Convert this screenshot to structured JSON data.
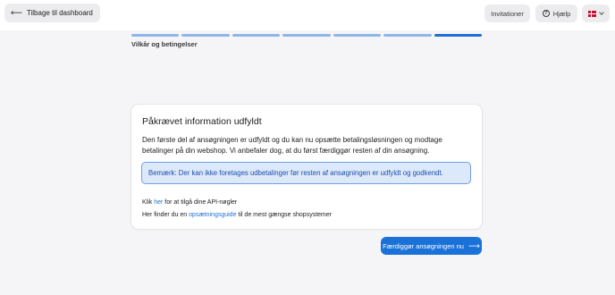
{
  "header": {
    "back_label": "Tilbage til dashboard",
    "invitations_label": "Invitationer",
    "help_label": "Hjælp",
    "language_flag": "flag-denmark"
  },
  "progress": {
    "total_steps": 7,
    "active_step": 7,
    "current_label": "Vilkår og betingelser",
    "colors": {
      "done": "#8fb6ea",
      "active": "#1d6fd6"
    }
  },
  "card": {
    "title": "Påkrævet information udfyldt",
    "body": "Den første del af ansøgningen er udfyldt og du kan nu opsætte betalingsløsningen og modtage betalinger på din webshop. Vi anbefaler dog, at du først færdiggør resten af din ansøgning.",
    "note": "Bemærk: Der kan ikke foretages udbetalinger før resten af ansøgningen er udfyldt og godkendt.",
    "line1_prefix": "Klik ",
    "line1_link": "her",
    "line1_suffix": " for at tilgå dine API-nøgler",
    "line2_prefix": "Her finder du en ",
    "line2_link": "opsætningsguide",
    "line2_suffix": " til de mest gængse shopsystemer"
  },
  "cta": {
    "label": "Færdiggør ansøgningen nu"
  },
  "colors": {
    "accent": "#1a72d9",
    "note_bg": "#dce9fb",
    "note_border": "#6f9fe3"
  }
}
